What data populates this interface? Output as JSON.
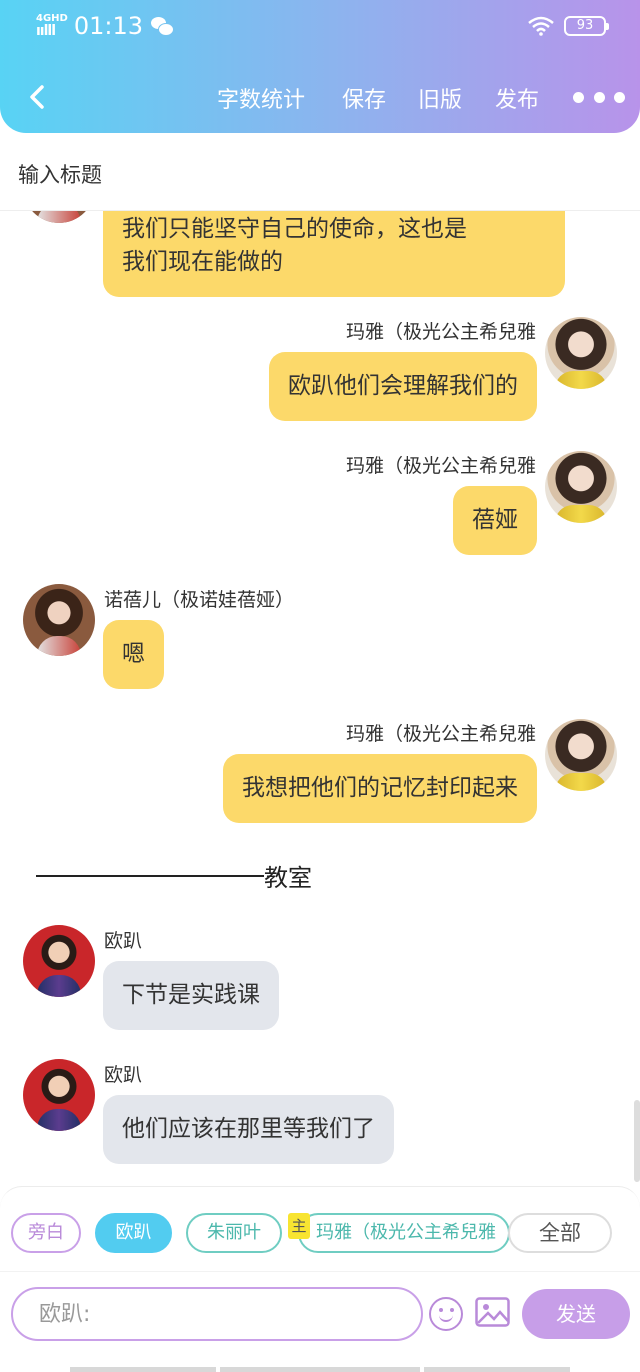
{
  "status_bar": {
    "network": "4GHD",
    "signal_bars": "ıılll",
    "time": "01:13",
    "battery": "93"
  },
  "navbar": {
    "back_icon": "chevron-left-icon",
    "word_count": "字数统计",
    "save": "保存",
    "old_version": "旧版",
    "publish": "发布",
    "more_icon": "more-dots-icon"
  },
  "title_input": {
    "placeholder": "输入标题"
  },
  "messages": [
    {
      "side": "left",
      "avatar": "nuo",
      "name": "",
      "text_lines": [
        "我们只能坚守自己的使命，这也是",
        "我们现在能做的"
      ],
      "color": "yellow"
    },
    {
      "side": "right",
      "avatar": "maya",
      "name": "玛雅（极光公主希兒雅",
      "text": "欧趴他们会理解我们的",
      "color": "yellow"
    },
    {
      "side": "right",
      "avatar": "maya",
      "name": "玛雅（极光公主希兒雅",
      "text": "蓓娅",
      "color": "yellow"
    },
    {
      "side": "left",
      "avatar": "nuo",
      "name": "诺蓓儿（极诺娃蓓娅）",
      "text": "嗯",
      "color": "yellow"
    },
    {
      "side": "right",
      "avatar": "maya",
      "name": "玛雅（极光公主希兒雅",
      "text": "我想把他们的记忆封印起来",
      "color": "yellow"
    },
    {
      "side": "left",
      "avatar": "oupa",
      "name": "欧趴",
      "text": "下节是实践课",
      "color": "grey"
    },
    {
      "side": "left",
      "avatar": "oupa",
      "name": "欧趴",
      "text": "他们应该在那里等我们了",
      "color": "grey"
    }
  ],
  "divider": {
    "label": "教室"
  },
  "roles": {
    "aside": "旁白",
    "oupa": "欧趴",
    "zhu": "朱丽叶",
    "host_tag": "主",
    "maya": "玛雅（极光公主希兒雅",
    "all": "全部"
  },
  "composer": {
    "placeholder": "欧趴:",
    "send": "发送",
    "emoji_icon": "smiley-icon",
    "image_icon": "image-icon"
  },
  "colors": {
    "header_gradient_start": "#58d3f4",
    "header_gradient_end": "#b893ea",
    "bubble_yellow": "#fcd96a",
    "bubble_grey": "#e3e6ec",
    "accent_purple": "#c79ee8",
    "accent_blue": "#52ccf0"
  }
}
